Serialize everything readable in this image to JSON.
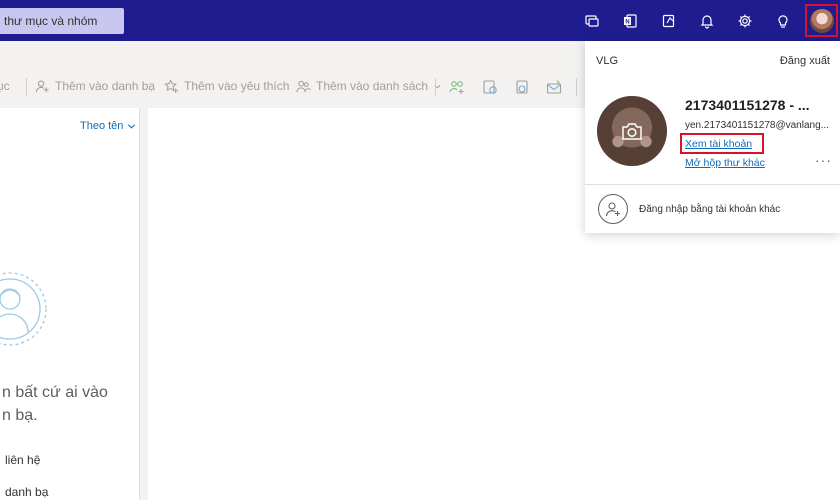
{
  "header": {
    "search_text": "thư mục và nhóm",
    "icons": [
      "teams-chat-icon",
      "onenote-icon",
      "my-day-icon",
      "bell-icon",
      "gear-icon",
      "lightbulb-icon"
    ]
  },
  "toolbar": {
    "truncated_left": "ục",
    "add_to_contacts": "Thêm vào danh bạ",
    "add_to_favorites": "Thêm vào yêu thích",
    "add_to_list": "Thêm vào danh sách"
  },
  "list": {
    "sort_label": "Theo tên",
    "empty_line1": "n bất cứ ai vào",
    "empty_line2": "n bạ.",
    "link1": "liên hệ",
    "link2": "danh bạ"
  },
  "account_menu": {
    "org": "VLG",
    "sign_out": "Đăng xuất",
    "name": "2173401151278 - ...",
    "email": "yen.2173401151278@vanlang...",
    "view_account": "Xem tài khoản",
    "open_mailbox": "Mở hộp thư khác",
    "more": "···",
    "other_account": "Đăng nhập bằng tài khoản khác"
  },
  "colors": {
    "header_bg": "#1f1c8f",
    "highlight_frame": "#d7132b",
    "link": "#0f6cbd"
  }
}
